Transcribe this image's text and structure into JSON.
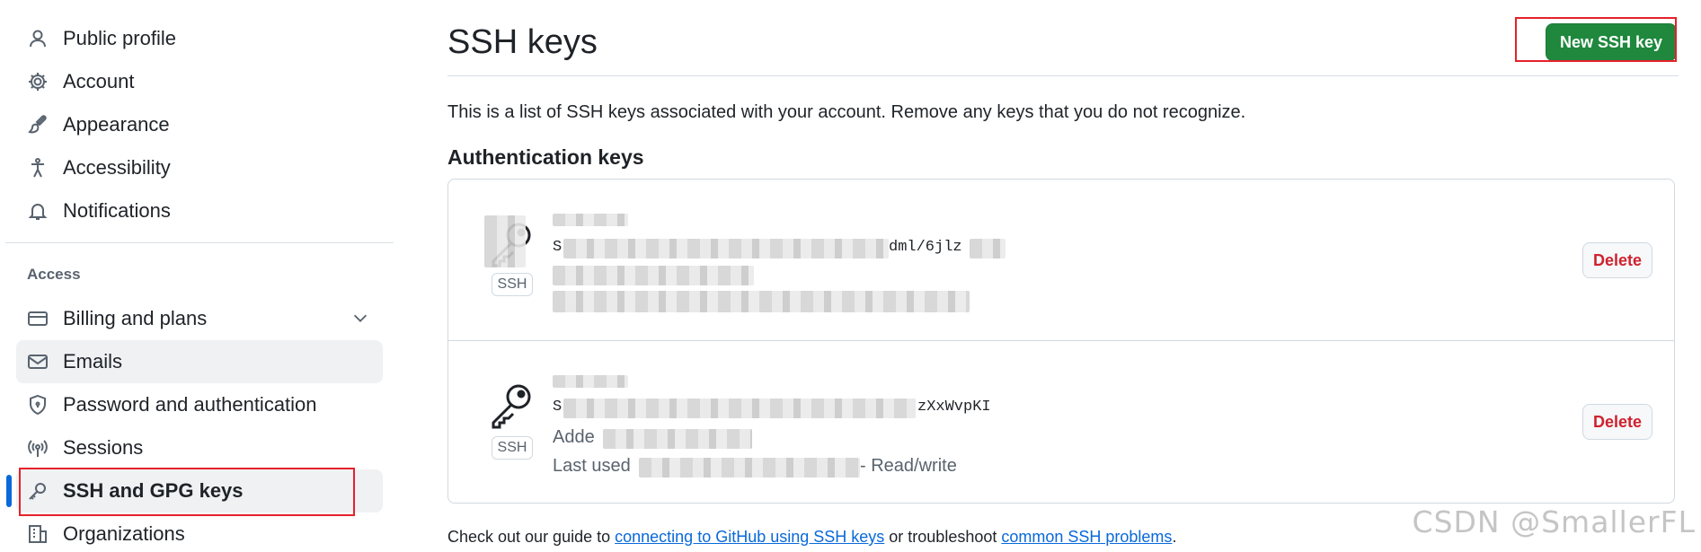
{
  "sidebar": {
    "items": [
      {
        "label": "Public profile",
        "icon": "person-icon"
      },
      {
        "label": "Account",
        "icon": "gear-icon"
      },
      {
        "label": "Appearance",
        "icon": "paintbrush-icon"
      },
      {
        "label": "Accessibility",
        "icon": "accessibility-icon"
      },
      {
        "label": "Notifications",
        "icon": "bell-icon"
      }
    ],
    "access_label": "Access",
    "access_items": [
      {
        "label": "Billing and plans",
        "icon": "credit-card-icon"
      },
      {
        "label": "Emails",
        "icon": "mail-icon"
      },
      {
        "label": "Password and authentication",
        "icon": "shield-lock-icon"
      },
      {
        "label": "Sessions",
        "icon": "broadcast-icon"
      },
      {
        "label": "SSH and GPG keys",
        "icon": "key-icon"
      },
      {
        "label": "Organizations",
        "icon": "organization-icon"
      }
    ]
  },
  "main": {
    "title": "SSH keys",
    "new_button": "New SSH key",
    "intro": "This is a list of SSH keys associated with your account. Remove any keys that you do not recognize.",
    "auth_heading": "Authentication keys",
    "keys": [
      {
        "badge": "SSH",
        "fingerprint_prefix": "S",
        "fingerprint_suffix": "dml/6jlz",
        "delete": "Delete"
      },
      {
        "badge": "SSH",
        "fingerprint_prefix": "S",
        "fingerprint_suffix": "zXxWvpKI",
        "added": "Adde",
        "last_used": "Last used",
        "access": "- Read/write",
        "delete": "Delete"
      }
    ],
    "footer": {
      "pre": "Check out our guide to ",
      "link1": "connecting to GitHub using SSH keys",
      "mid": " or troubleshoot ",
      "link2": "common SSH problems",
      "post": "."
    }
  },
  "watermark": "CSDN @SmallerFL",
  "colors": {
    "accent": "#0969da",
    "primary_button": "#1f883d",
    "danger": "#cf222e",
    "annotation_box": "#e5212b"
  }
}
